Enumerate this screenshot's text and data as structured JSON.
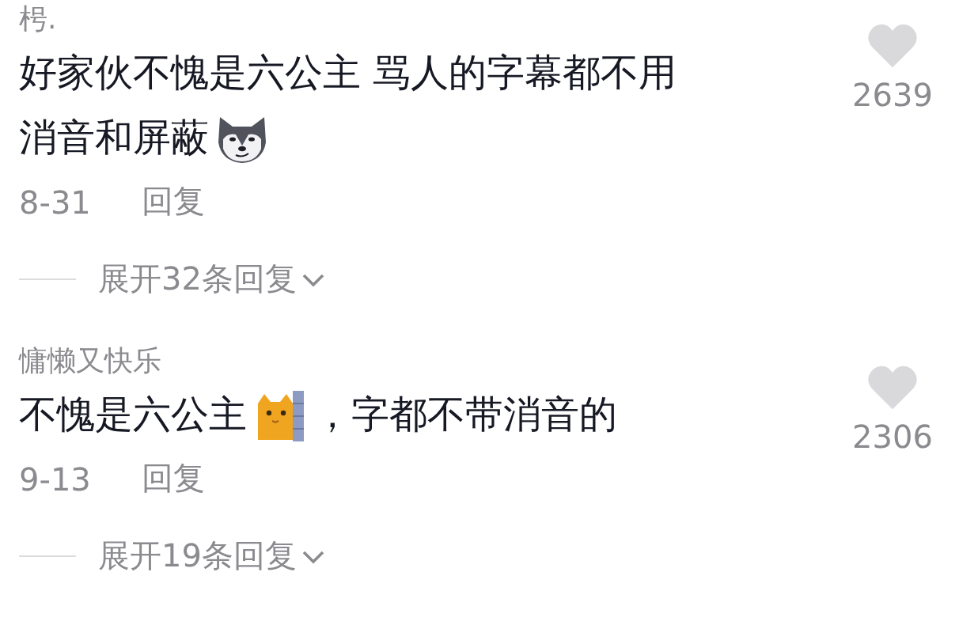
{
  "comments": [
    {
      "user": "枵.",
      "parts": [
        {
          "kind": "text",
          "text": "好家伙不愧是六公主 骂人的字幕都不用"
        },
        {
          "kind": "text",
          "text": "消音和屏蔽"
        },
        {
          "kind": "dog_sticker"
        }
      ],
      "likes": "2639",
      "date": "8-31",
      "reply_label": "回复",
      "expand_label": "展开32条回复"
    },
    {
      "user": "慵懒又快乐",
      "parts": [
        {
          "kind": "text",
          "text": "不愧是六公主"
        },
        {
          "kind": "cat_sticker"
        },
        {
          "kind": "text",
          "text": "，字都不带消音的"
        }
      ],
      "likes": "2306",
      "date": "9-13",
      "reply_label": "回复",
      "expand_label": "展开19条回复"
    }
  ]
}
